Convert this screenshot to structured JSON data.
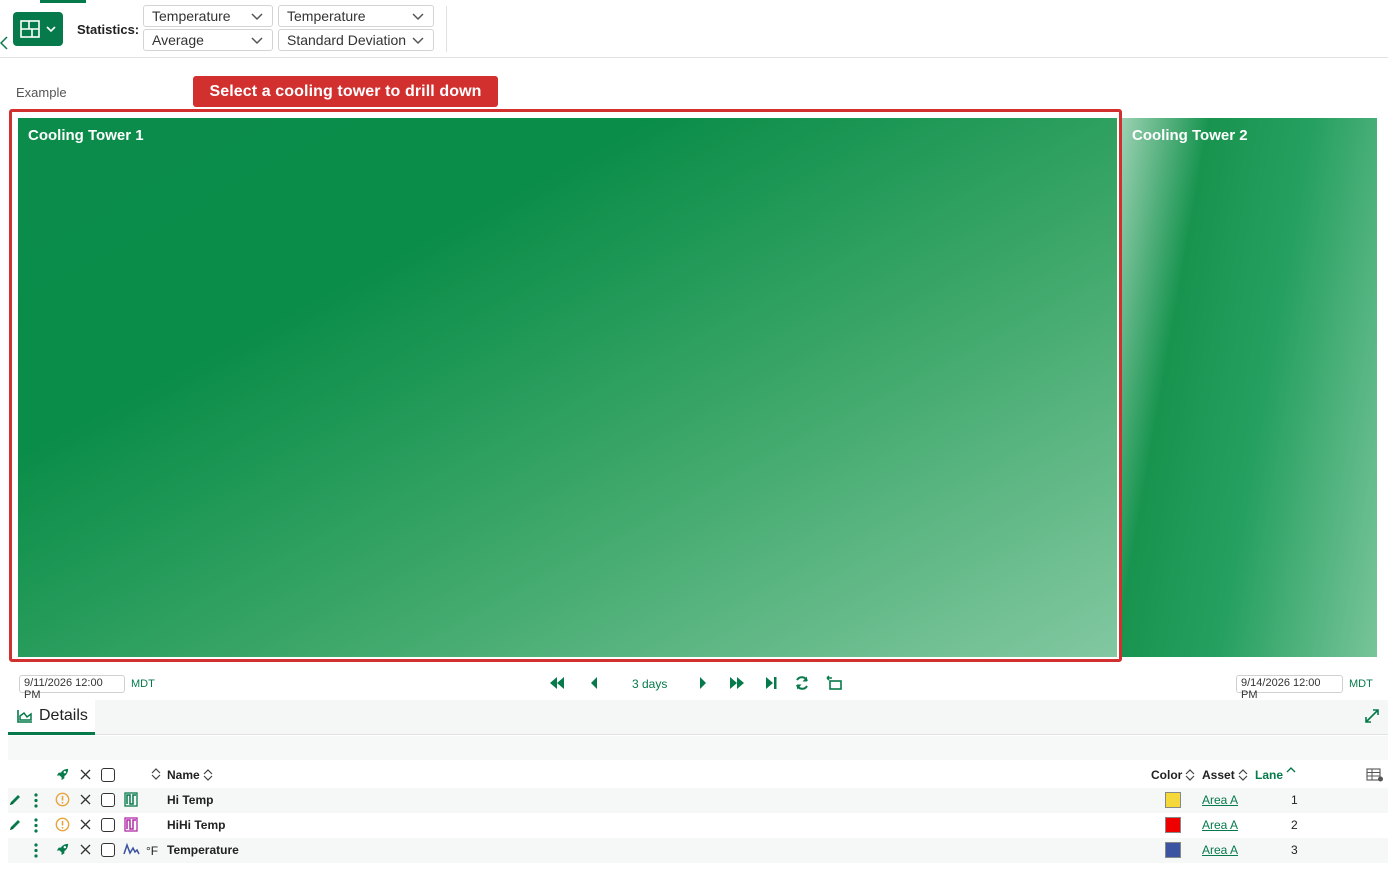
{
  "toolbar": {
    "statistics_label": "Statistics:",
    "stat_selects": [
      {
        "value": "Temperature"
      },
      {
        "value": "Temperature"
      },
      {
        "value": "Average"
      },
      {
        "value": "Standard Deviation"
      }
    ]
  },
  "main": {
    "example_label": "Example",
    "callout": "Select a cooling tower to drill down",
    "tiles": [
      {
        "label": "Cooling Tower 1"
      },
      {
        "label": "Cooling Tower 2"
      }
    ]
  },
  "timebar": {
    "start": "9/11/2026 12:00 PM",
    "start_tz": "MDT",
    "range": "3 days",
    "end": "9/14/2026 12:00 PM",
    "end_tz": "MDT"
  },
  "details": {
    "tab_label": "Details",
    "columns": {
      "name": "Name",
      "color": "Color",
      "asset": "Asset",
      "lane": "Lane"
    },
    "rows": [
      {
        "unit": "",
        "name": "Hi Temp",
        "color": "#f5d93a",
        "asset": "Area A",
        "lane": "1",
        "icon": "condition-icon",
        "icon_color": "#067a4a"
      },
      {
        "unit": "",
        "name": "HiHi Temp",
        "color": "#ee0000",
        "asset": "Area A",
        "lane": "2",
        "icon": "condition-icon",
        "icon_color": "#b02aa8"
      },
      {
        "unit": "°F",
        "name": "Temperature",
        "color": "#3b53a0",
        "asset": "Area A",
        "lane": "3",
        "icon": "signal-icon",
        "icon_color": "#3b53a0"
      }
    ]
  }
}
